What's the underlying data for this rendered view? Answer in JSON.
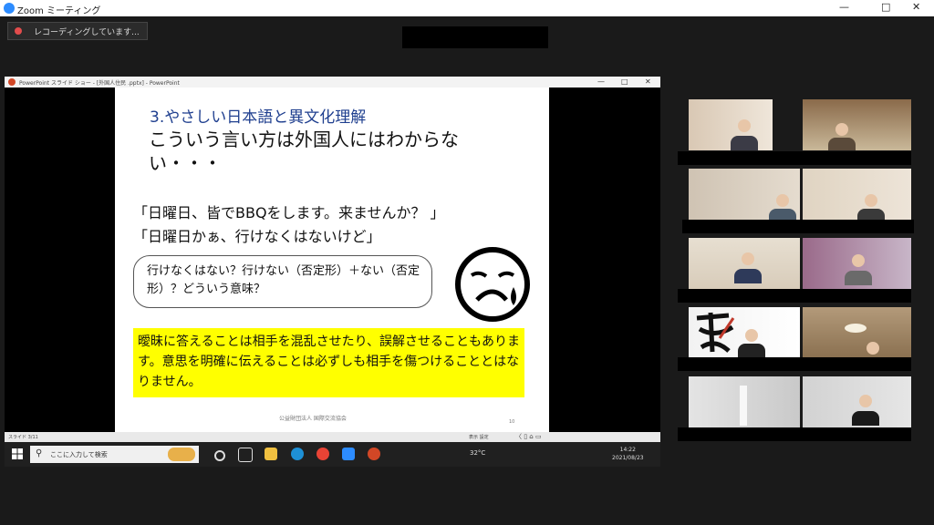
{
  "window": {
    "title": "Zoom ミーティング",
    "minimize": "—",
    "maximize": "□",
    "close": "✕"
  },
  "recording": {
    "label": "レコーディングしています..."
  },
  "powerpoint": {
    "titlebar": "PowerPoint スライド ショー - [外国人住民 .pptx] - PowerPoint",
    "min": "—",
    "max": "□",
    "close": "✕",
    "status_left": "スライド 3/11",
    "status_mid": "表示 設定",
    "status_right": "〈   ▯   ⌂   ▭"
  },
  "slide": {
    "heading": "3.やさしい日本語と異文化理解",
    "subheading": "こういう言い方は外国人にはわからない・・・",
    "quote1": "「日曜日、皆でBBQをします。来ませんか？ 」",
    "quote2": "「日曜日かぁ、行けなくはないけど」",
    "bubble": "行けなくはない？行けない（否定形）＋ない（否定形）？どういう意味？",
    "highlight": "曖昧に答えることは相手を混乱させたり、誤解させることもあります。意思を明確に伝えることは必ずしも相手を傷つけることとはなりません。",
    "footnote": "公益財団法人 国際交流協会",
    "page_number": "10"
  },
  "taskbar": {
    "search_placeholder": "ここに入力して検索",
    "weather": "32°C",
    "clock_time": "14:22",
    "clock_date": "2021/08/23"
  },
  "colors": {
    "zoom_blue": "#2d8cff",
    "heading_blue": "#1f3f8f",
    "highlight_yellow": "#ffff00",
    "record_red": "#e34c4c"
  }
}
